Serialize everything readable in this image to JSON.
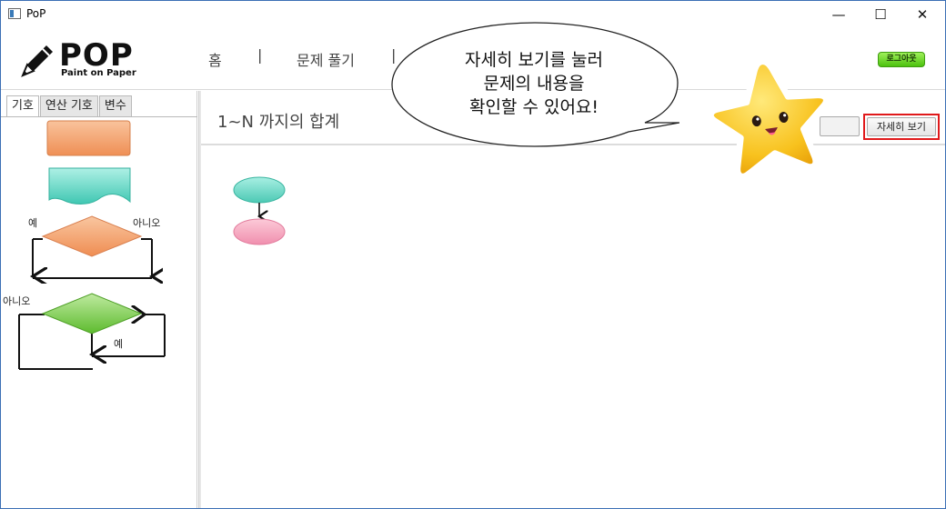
{
  "window": {
    "title": "PoP",
    "minimize_glyph": "—",
    "maximize_glyph": "☐",
    "close_glyph": "✕"
  },
  "logo": {
    "title": "POP",
    "subtitle": "Paint on Paper",
    "icon": "pencil-icon"
  },
  "nav": {
    "home": "홈",
    "separator": "|",
    "solve": "문제 풀기"
  },
  "logout_label": "로그아웃",
  "palette": {
    "tabs": [
      "기호",
      "연산 기호",
      "변수"
    ],
    "active_tab": 0,
    "decision_yes": "예",
    "decision_no": "아니오",
    "loop_no": "아니오",
    "loop_yes": "예",
    "colors": {
      "process": "#f4a36e",
      "input_output": "#5fd6c4",
      "decision": "#f4a36e",
      "loop": "#84cd5a"
    }
  },
  "main": {
    "problem_title": "1~N 까지의 합계",
    "detail_button": "자세히 보기",
    "detail_button_highlight": "#e0191b",
    "canvas_nodes": [
      {
        "name": "start-node",
        "color": "#6fdac7"
      },
      {
        "name": "end-node",
        "color": "#f6a9bf"
      }
    ]
  },
  "callout": {
    "lines": [
      "자세히 보기를 눌러",
      "문제의 내용을",
      "확인할 수 있어요!"
    ],
    "mascot": "star-mascot-icon"
  }
}
